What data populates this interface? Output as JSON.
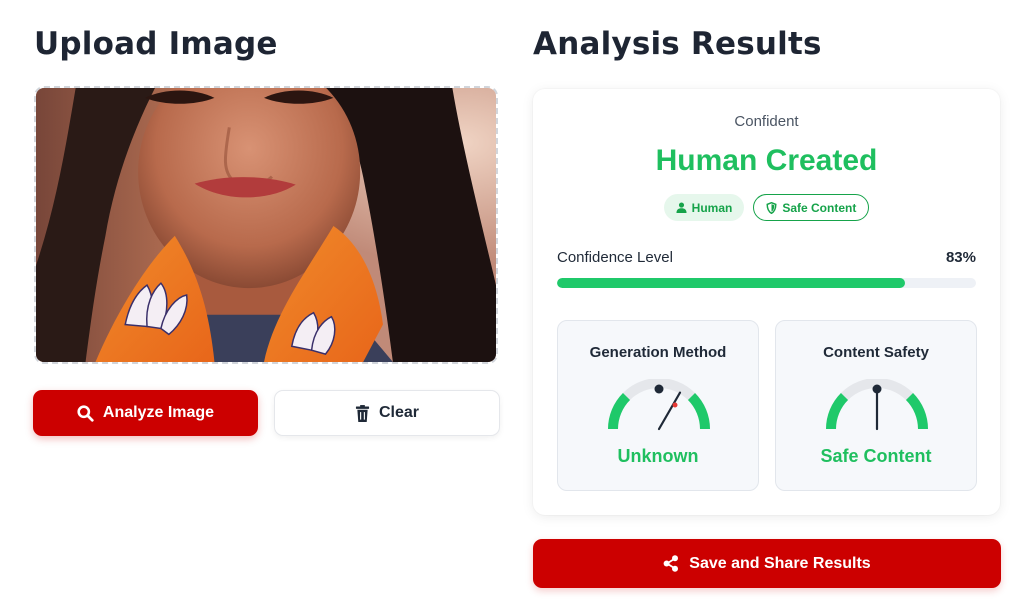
{
  "upload": {
    "title": "Upload Image",
    "image_alt": "Uploaded photo of a smiling woman with long dark hair wearing an orange scarf with white lotus prints"
  },
  "actions": {
    "analyze_label": "Analyze Image",
    "clear_label": "Clear",
    "analyze_icon": "search-icon",
    "clear_icon": "trash-icon"
  },
  "results": {
    "title": "Analysis Results",
    "confidence_text": "Confident",
    "verdict": "Human Created",
    "badges": [
      {
        "label": "Human",
        "icon": "user-icon"
      },
      {
        "label": "Safe Content",
        "icon": "shield-icon"
      }
    ],
    "confidence_label": "Confidence Level",
    "confidence_value": "83%",
    "confidence_fraction": 0.83,
    "metrics": [
      {
        "title": "Generation Method",
        "value": "Unknown",
        "needle_angle_deg": 30
      },
      {
        "title": "Content Safety",
        "value": "Safe Content",
        "needle_angle_deg": 0
      }
    ],
    "share_label": "Save and Share Results",
    "share_icon": "share-icon"
  },
  "colors": {
    "brand_red": "#cc0000",
    "success_green": "#1fbf5f",
    "gauge_green": "#1fc96a",
    "gauge_track": "#e5e7eb",
    "needle": "#1f2937",
    "needle_dot_alert": "#e53935"
  }
}
